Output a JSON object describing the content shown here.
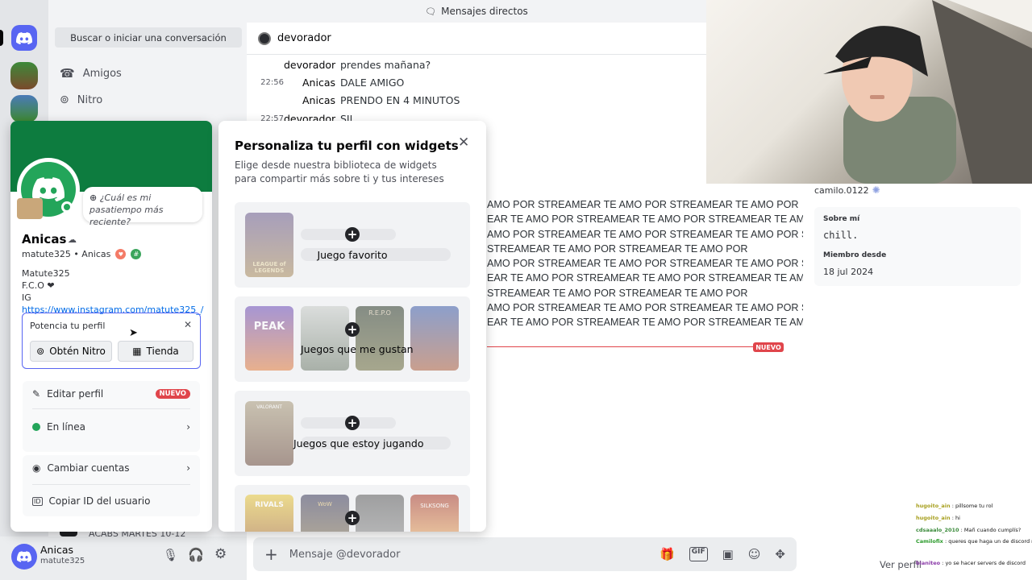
{
  "topbar": {
    "title": "Mensajes directos"
  },
  "dm_list": {
    "search_label": "Buscar o iniciar una conversación",
    "friends_label": "Amigos",
    "nitro_label": "Nitro",
    "partial_channel": "ACABS MARTES 10-12"
  },
  "channel": {
    "name": "devorador"
  },
  "messages": [
    {
      "time": "",
      "author": "devorador",
      "text": "prendes mañana?"
    },
    {
      "time": "22:56",
      "author": "Anicas",
      "text": "DALE AMIGO"
    },
    {
      "time": "",
      "author": "Anicas",
      "text": "PRENDO EN 4 MINUTOS"
    },
    {
      "time": "22:57",
      "author": "devorador",
      "text": "SII"
    }
  ],
  "spam_lines": [
    "AMO POR STREAMEAR TE AMO POR STREAMEAR TE AMO POR",
    "EAR TE AMO POR STREAMEAR TE AMO POR STREAMEAR TE AMO",
    "AMO POR STREAMEAR TE AMO POR STREAMEAR TE AMO POR STREAMEAR TE",
    "STREAMEAR TE AMO POR STREAMEAR TE AMO POR",
    "AMO POR STREAMEAR TE AMO POR STREAMEAR TE AMO POR STREAMEAR TE AMO",
    "EAR TE AMO POR STREAMEAR TE AMO POR STREAMEAR TE AMO POR STREAMEAR TE",
    "STREAMEAR TE AMO POR STREAMEAR TE AMO POR",
    "AMO POR STREAMEAR TE AMO POR STREAMEAR TE AMO POR STREAMEAR TE AMO",
    "EAR TE AMO POR STREAMEAR TE AMO POR STREAMEAR TE AMO POR STREAMEAR TE"
  ],
  "new_badge": "NUEVO",
  "right_panel": {
    "username": "camilo.0122",
    "about_heading": "Sobre mí",
    "about_text": "chill.",
    "member_since_heading": "Miembro desde",
    "member_since": "18 jul 2024",
    "view_profile": "Ver perfil"
  },
  "composer": {
    "placeholder": "Mensaje @devorador"
  },
  "user_bar": {
    "display_name": "Anicas",
    "username": "matute325"
  },
  "profile": {
    "status_prompt": "¿Cuál es mi pasatiempo más reciente?",
    "display_name": "Anicas",
    "handle_line": "matute325 • Anicas",
    "bio_line1": "Matute325",
    "bio_line2": "F.C.O ❤",
    "bio_ig_prefix": "IG ",
    "bio_ig_link": "https://www.instagram.com/matute325_/",
    "boost_title": "Potencia tu perfil",
    "get_nitro": "Obtén Nitro",
    "shop": "Tienda",
    "edit_profile": "Editar perfil",
    "edit_badge": "NUEVO",
    "status": "En línea",
    "switch_accounts": "Cambiar cuentas",
    "copy_id": "Copiar ID del usuario"
  },
  "widgets_modal": {
    "title": "Personaliza tu perfil con widgets",
    "subtitle": "Elige desde nuestra biblioteca de widgets para compartir más sobre ti y tus intereses",
    "cards": [
      {
        "label": "Juego favorito"
      },
      {
        "label": "Juegos que me gustan"
      },
      {
        "label": "Juegos que estoy jugando"
      }
    ],
    "thumb_labels": {
      "lol": "LEAGUE of LEGENDS",
      "peak": "PEAK",
      "repo": "R.E.P.O",
      "valorant": "VALORANT",
      "rivals": "RIVALS",
      "wow": "WoW",
      "silksong": "SILKSONG"
    }
  },
  "stream_chat": [
    {
      "user": "hugoito_ain",
      "text": "pillsome tu rol"
    },
    {
      "user": "hugoito_ain",
      "text": "hi"
    },
    {
      "user": "cdsaaalo_2010",
      "text": "Mañ cuando cumplís?"
    },
    {
      "user": "Camilofix",
      "text": "queres que haga un de discord mañ?"
    },
    {
      "user": "bianiteo",
      "text": "yo se hacer servers de discord"
    }
  ],
  "colors": {
    "discord_blurple": "#5865f2",
    "banner_green": "#0d7c3f",
    "online_green": "#23a55a",
    "new_red": "#e0454b",
    "link_blue": "#006ce7"
  }
}
